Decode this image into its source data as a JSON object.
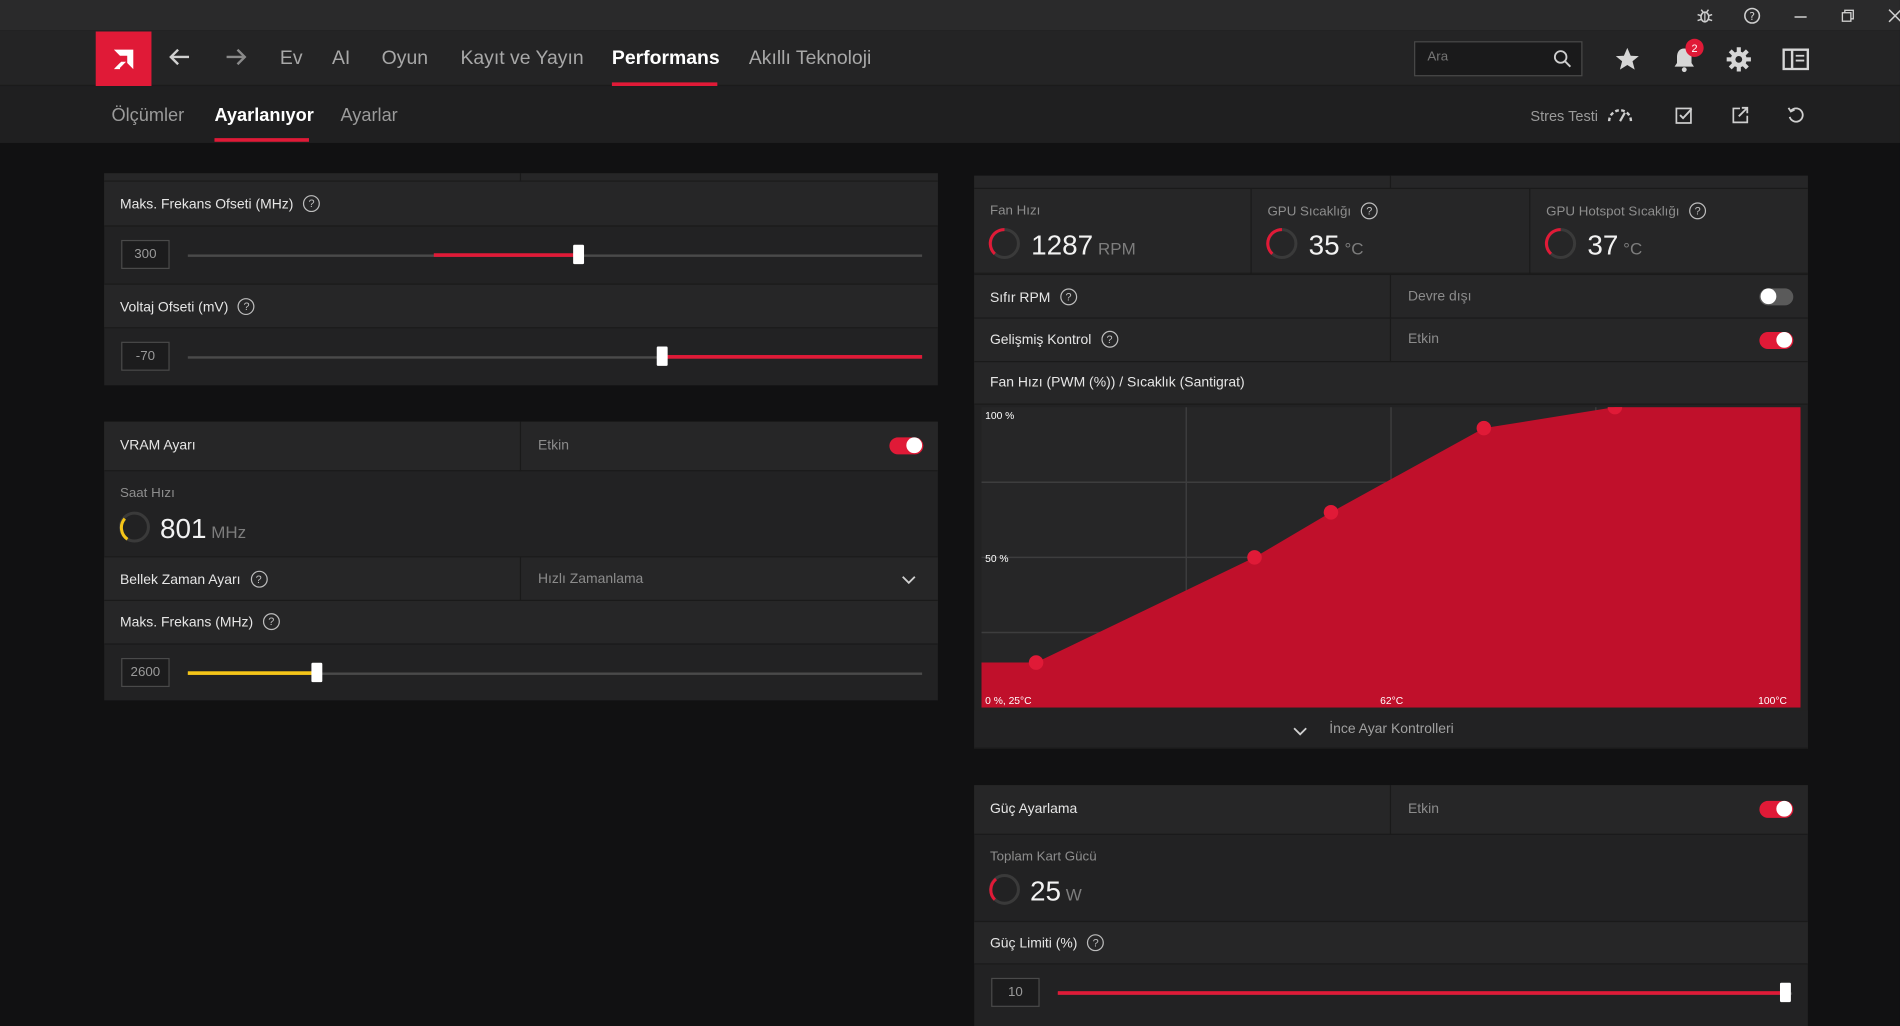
{
  "titlebar": {
    "icons": [
      "bug-icon",
      "help-icon",
      "minimize-icon",
      "restore-icon",
      "close-icon"
    ]
  },
  "nav": {
    "items": [
      "Ev",
      "AI",
      "Oyun",
      "Kayıt ve Yayın",
      "Performans",
      "Akıllı Teknoloji"
    ],
    "active": "Performans",
    "search_placeholder": "Ara",
    "notification_count": "2"
  },
  "subnav": {
    "tabs": [
      "Ölçümler",
      "Ayarlanıyor",
      "Ayarlar"
    ],
    "active": "Ayarlanıyor",
    "stress_test": "Stres Testi"
  },
  "left": {
    "max_freq_offset": {
      "label": "Maks. Frekans Ofseti (MHz)",
      "value": "300",
      "position": 0.53
    },
    "voltage_offset": {
      "label": "Voltaj Ofseti (mV)",
      "value": "-70",
      "position": 0.65
    },
    "vram": {
      "label": "VRAM Ayarı",
      "state": "Etkin",
      "enabled": true,
      "clock_label": "Saat Hızı",
      "clock_value": "801",
      "clock_unit": "MHz"
    },
    "memory_timing": {
      "label": "Bellek Zaman Ayarı",
      "value": "Hızlı Zamanlama"
    },
    "max_freq": {
      "label": "Maks. Frekans (MHz)",
      "value": "2600",
      "position": 0.175
    }
  },
  "right": {
    "metrics": [
      {
        "label": "Fan Hızı",
        "value": "1287",
        "unit": "RPM",
        "help": false
      },
      {
        "label": "GPU Sıcaklığı",
        "value": "35",
        "unit": "°C",
        "help": true
      },
      {
        "label": "GPU Hotspot Sıcaklığı",
        "value": "37",
        "unit": "°C",
        "help": true
      }
    ],
    "zero_rpm": {
      "label": "Sıfır RPM",
      "state": "Devre dışı",
      "enabled": false
    },
    "advanced_control": {
      "label": "Gelişmiş Kontrol",
      "state": "Etkin",
      "enabled": true
    },
    "fan_curve_title": "Fan Hızı (PWM (%)) / Sıcaklık (Santigrat)",
    "fine_tune": "İnce Ayar Kontrolleri",
    "power": {
      "label": "Güç Ayarlama",
      "state": "Etkin",
      "enabled": true,
      "total_label": "Toplam Kart Gücü",
      "total_value": "25",
      "total_unit": "W"
    },
    "power_limit": {
      "label": "Güç Limiti (%)",
      "value": "10",
      "position": 1.0
    }
  },
  "chart_data": {
    "type": "area",
    "title": "Fan Hızı (PWM (%)) / Sıcaklık (Santigrat)",
    "xlabel": "",
    "ylabel": "",
    "tick_labels": {
      "y_top": "100 %",
      "y_mid": "50 %",
      "origin": "0 %, 25°C",
      "x_mid": "62°C",
      "x_right": "100°C"
    },
    "x_range": [
      25,
      100
    ],
    "y_range": [
      0,
      100
    ],
    "points": [
      {
        "x": 30,
        "y": 15
      },
      {
        "x": 50,
        "y": 50
      },
      {
        "x": 57,
        "y": 65
      },
      {
        "x": 71,
        "y": 93
      },
      {
        "x": 83,
        "y": 100
      }
    ],
    "color": "#c0102b",
    "grid": true
  }
}
